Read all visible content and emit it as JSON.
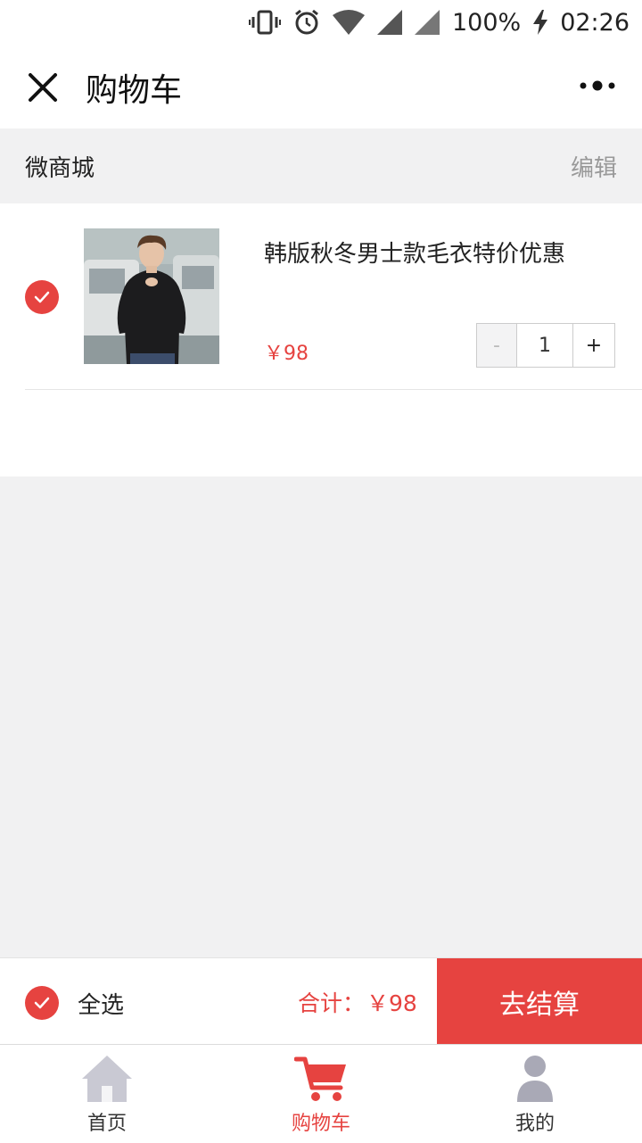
{
  "status_bar": {
    "battery": "100%",
    "time": "02:26",
    "icons": [
      "vibrate-icon",
      "alarm-icon",
      "wifi-icon",
      "signal-icon",
      "signal-icon-2",
      "charging-icon"
    ]
  },
  "nav": {
    "title": "购物车",
    "close_icon": "close-icon",
    "more_icon": "more-icon"
  },
  "shop": {
    "name": "微商城",
    "edit_label": "编辑"
  },
  "cart_items": [
    {
      "title": "韩版秋冬男士款毛衣特价优惠",
      "price": "￥98",
      "quantity": "1",
      "minus_label": "-",
      "plus_label": "+",
      "selected": true,
      "image": "product-photo"
    }
  ],
  "footer": {
    "select_all_label": "全选",
    "total_label": "合计：",
    "total_value": "￥98",
    "checkout_label": "去结算",
    "all_selected": true
  },
  "tabbar": {
    "items": [
      {
        "label": "首页",
        "icon": "home-icon",
        "active": false
      },
      {
        "label": "购物车",
        "icon": "cart-icon",
        "active": true
      },
      {
        "label": "我的",
        "icon": "user-icon",
        "active": false
      }
    ]
  },
  "colors": {
    "accent": "#e64340",
    "background": "#f1f1f2",
    "inactive_icon": "#c9c9d3"
  }
}
